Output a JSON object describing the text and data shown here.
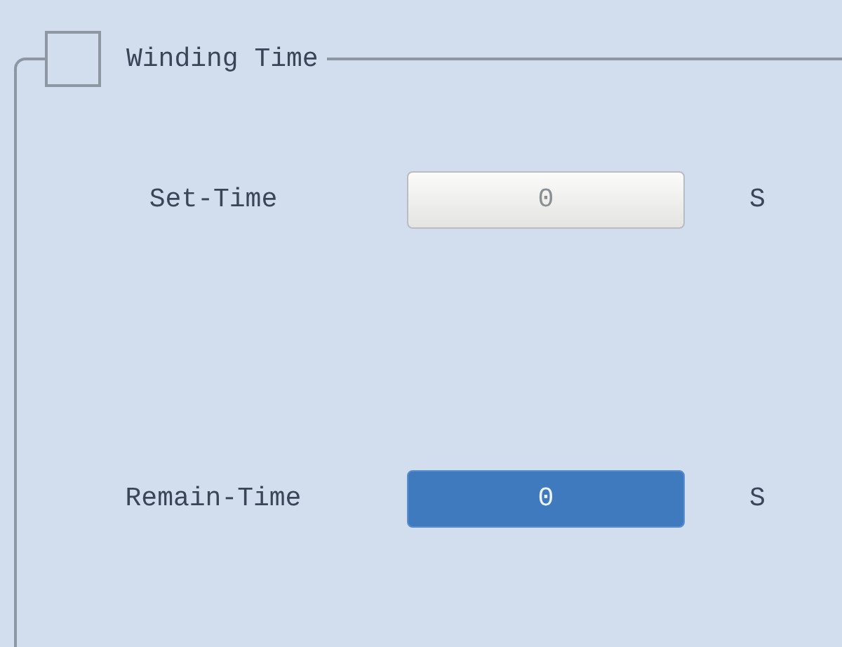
{
  "group": {
    "title": "Winding Time",
    "checked": false,
    "rows": [
      {
        "label": "Set-Time",
        "kind": "input",
        "value": "0",
        "unit": "S"
      },
      {
        "label": "Remain-Time",
        "kind": "display",
        "value": "0",
        "unit": "S"
      }
    ]
  }
}
